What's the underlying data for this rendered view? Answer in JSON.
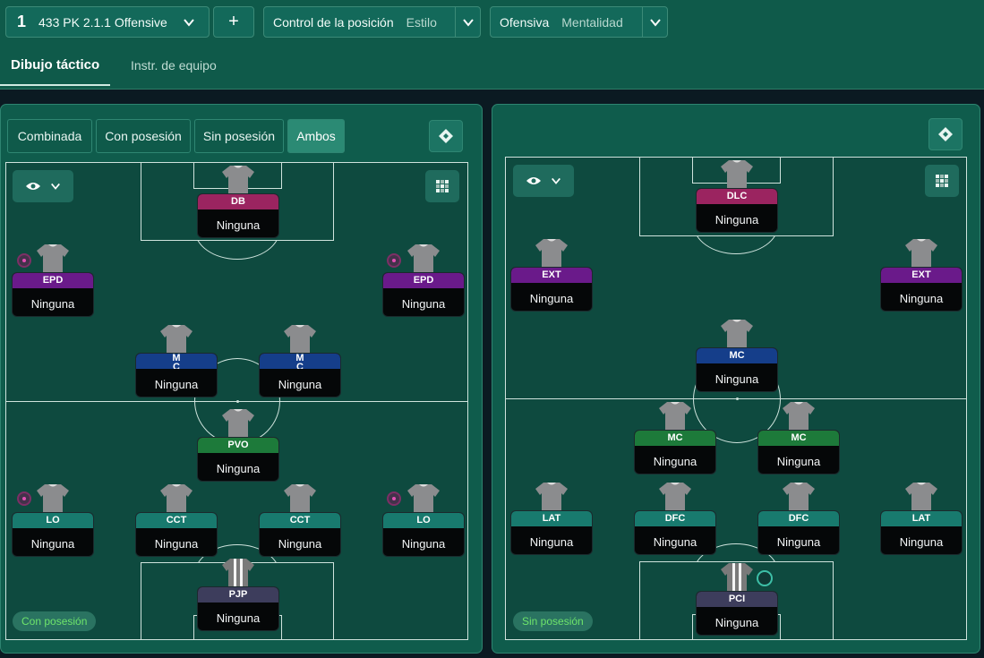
{
  "topbar": {
    "tactic_number": "1",
    "tactic_name": "433 PK 2.1.1 Offensive",
    "add_label": "+",
    "style_value": "Control de la posición",
    "style_label": "Estilo",
    "mentality_value": "Ofensiva",
    "mentality_label": "Mentalidad"
  },
  "tabs": {
    "active": "Dibujo táctico",
    "other": "Instr. de equipo"
  },
  "left_panel": {
    "segments": [
      "Combinada",
      "Con posesión",
      "Sin posesión",
      "Ambos"
    ],
    "active_segment": "Ambos",
    "phase_label": "Con posesión",
    "players": [
      {
        "role": "DB",
        "duty": "Ninguna",
        "color": "#9b2460"
      },
      {
        "role": "EPD",
        "duty": "Ninguna",
        "color": "#6a1a8a"
      },
      {
        "role": "EPD",
        "duty": "Ninguna",
        "color": "#6a1a8a"
      },
      {
        "role": "M\nC",
        "duty": "Ninguna",
        "color": "#153e8a"
      },
      {
        "role": "M\nC",
        "duty": "Ninguna",
        "color": "#153e8a"
      },
      {
        "role": "PVO",
        "duty": "Ninguna",
        "color": "#1d7a3a"
      },
      {
        "role": "LO",
        "duty": "Ninguna",
        "color": "#187a6e"
      },
      {
        "role": "CCT",
        "duty": "Ninguna",
        "color": "#187a6e"
      },
      {
        "role": "CCT",
        "duty": "Ninguna",
        "color": "#187a6e"
      },
      {
        "role": "LO",
        "duty": "Ninguna",
        "color": "#187a6e"
      },
      {
        "role": "PJP",
        "duty": "Ninguna",
        "color": "#3d3d5c"
      }
    ]
  },
  "right_panel": {
    "phase_label": "Sin posesión",
    "players": [
      {
        "role": "DLC",
        "duty": "Ninguna",
        "color": "#9b2460"
      },
      {
        "role": "EXT",
        "duty": "Ninguna",
        "color": "#6a1a8a"
      },
      {
        "role": "EXT",
        "duty": "Ninguna",
        "color": "#6a1a8a"
      },
      {
        "role": "MC",
        "duty": "Ninguna",
        "color": "#153e8a"
      },
      {
        "role": "MC",
        "duty": "Ninguna",
        "color": "#1d7a3a"
      },
      {
        "role": "MC",
        "duty": "Ninguna",
        "color": "#1d7a3a"
      },
      {
        "role": "LAT",
        "duty": "Ninguna",
        "color": "#187a6e"
      },
      {
        "role": "DFC",
        "duty": "Ninguna",
        "color": "#187a6e"
      },
      {
        "role": "DFC",
        "duty": "Ninguna",
        "color": "#187a6e"
      },
      {
        "role": "LAT",
        "duty": "Ninguna",
        "color": "#187a6e"
      },
      {
        "role": "PCI",
        "duty": "Ninguna",
        "color": "#3d3d5c"
      }
    ]
  }
}
